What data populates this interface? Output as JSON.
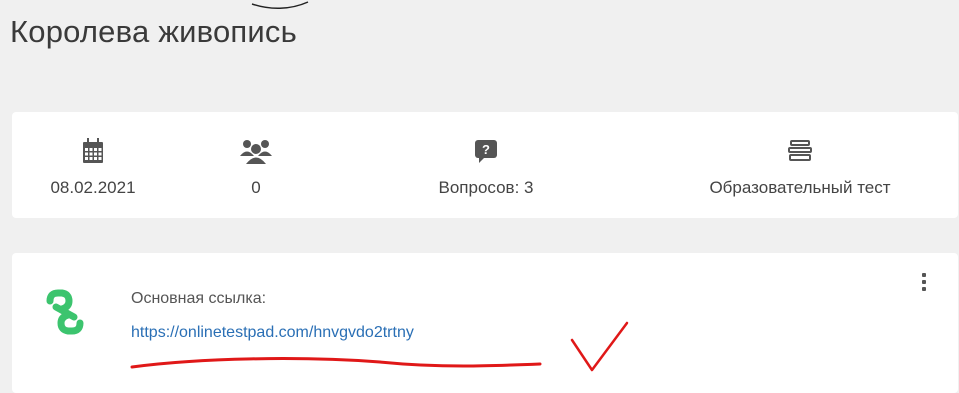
{
  "page": {
    "title": "Королева живопись"
  },
  "stats": [
    {
      "icon": "calendar-icon",
      "value": "08.02.2021"
    },
    {
      "icon": "users-icon",
      "value": "0"
    },
    {
      "icon": "question-icon",
      "value": "Вопросов: 3"
    },
    {
      "icon": "books-icon",
      "value": "Образовательный тест"
    }
  ],
  "link": {
    "icon": "link-icon",
    "label": "Основная ссылка:",
    "url": "https://onlinetestpad.com/hnvgvdo2trtny",
    "menu_icon": "more-vertical-icon"
  },
  "colors": {
    "background": "#f0f0f0",
    "card": "#ffffff",
    "link": "#2a6fb5",
    "link_icon": "#3cc46e",
    "icon": "#555555",
    "annotation": "#e01818"
  }
}
